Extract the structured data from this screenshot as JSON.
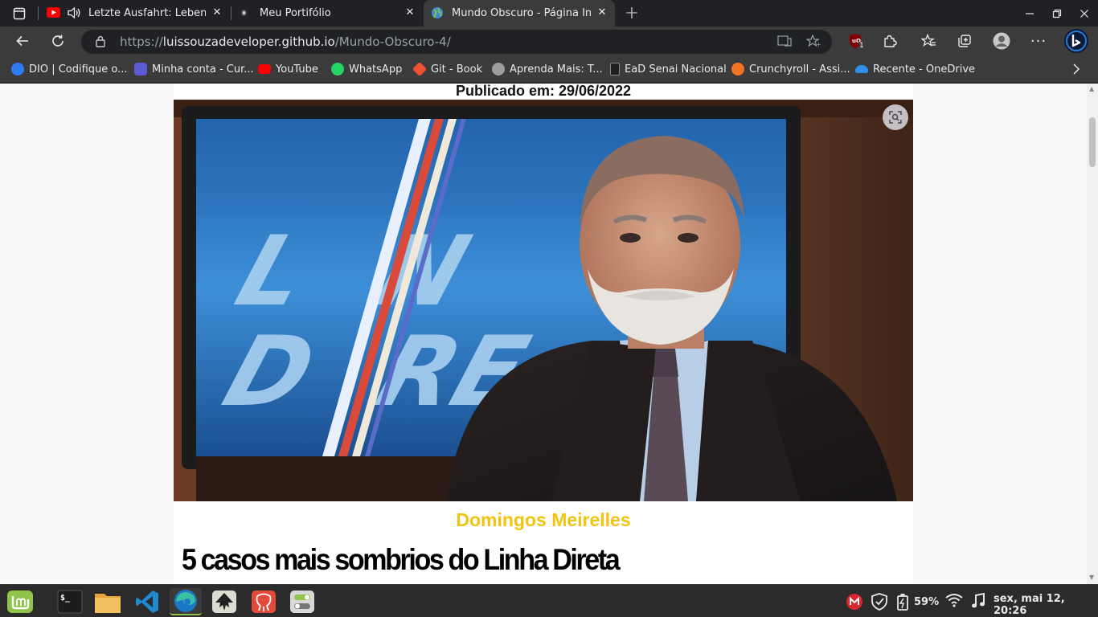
{
  "browser": {
    "tabs": [
      {
        "title": "Letzte Ausfahrt: Leben - Y",
        "icon": "youtube-icon",
        "audio": true,
        "active": false
      },
      {
        "title": "Meu Portifólio",
        "icon": "portfolio-icon",
        "active": false
      },
      {
        "title": "Mundo Obscuro - Página Inicial",
        "icon": "globe-icon",
        "active": true
      }
    ],
    "url": {
      "scheme": "https://",
      "host": "luissouzadeveloper.github.io",
      "path": "/Mundo-Obscuro-4/"
    },
    "extension_badge": "1",
    "bookmarks": [
      {
        "label": "DIO | Codifique o...",
        "color": "#2d7cf6"
      },
      {
        "label": "Minha conta - Cur...",
        "color": "#5b5bd6"
      },
      {
        "label": "YouTube",
        "color": "#ff0000"
      },
      {
        "label": "WhatsApp",
        "color": "#25d366"
      },
      {
        "label": "Git - Book",
        "color": "#f05133"
      },
      {
        "label": "Aprenda Mais: T...",
        "color": "#9e9e9e"
      },
      {
        "label": "EaD Senai Nacional",
        "color": "#1f1f1f"
      },
      {
        "label": "Crunchyroll - Assi...",
        "color": "#f47521"
      },
      {
        "label": "Recente - OneDrive",
        "color": "#2f8fe8"
      }
    ]
  },
  "article": {
    "published": "Publicado em: 29/06/2022",
    "caption": "Domingos Meirelles",
    "headline": "5 casos mais sombrios do Linha Direta",
    "caption_color": "#f1c40f"
  },
  "taskbar": {
    "apps": [
      "mint-menu-icon",
      "terminal-icon",
      "files-icon",
      "vscode-icon",
      "edge-icon",
      "inkscape-icon",
      "gitkraken-icon",
      "toggle-app-icon"
    ],
    "battery": "59%",
    "clock": "sex, mai 12, 20:26"
  }
}
